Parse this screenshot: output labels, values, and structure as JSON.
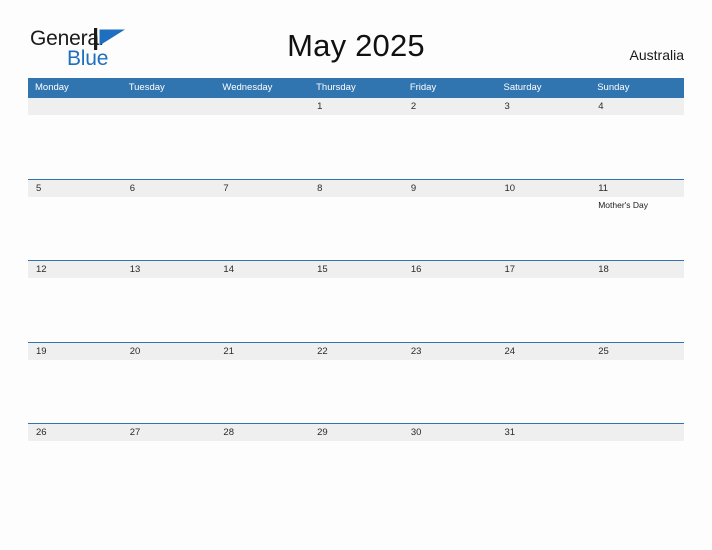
{
  "brand": {
    "name_part1": "General",
    "name_part2": "Blue",
    "flag_color": "#1f6fc0",
    "text_color": "#1a1a1a"
  },
  "header": {
    "title": "May 2025",
    "country": "Australia"
  },
  "theme": {
    "header_blue": "#3175b0",
    "date_band_gray": "#efefef",
    "page_background": "#fdfdfd",
    "accent_blue": "#1f6fc0"
  },
  "calendar": {
    "weekday_headers": [
      "Monday",
      "Tuesday",
      "Wednesday",
      "Thursday",
      "Friday",
      "Saturday",
      "Sunday"
    ],
    "weeks": [
      {
        "days": [
          {
            "num": "",
            "event": ""
          },
          {
            "num": "",
            "event": ""
          },
          {
            "num": "",
            "event": ""
          },
          {
            "num": "1",
            "event": ""
          },
          {
            "num": "2",
            "event": ""
          },
          {
            "num": "3",
            "event": ""
          },
          {
            "num": "4",
            "event": ""
          }
        ]
      },
      {
        "days": [
          {
            "num": "5",
            "event": ""
          },
          {
            "num": "6",
            "event": ""
          },
          {
            "num": "7",
            "event": ""
          },
          {
            "num": "8",
            "event": ""
          },
          {
            "num": "9",
            "event": ""
          },
          {
            "num": "10",
            "event": ""
          },
          {
            "num": "11",
            "event": "Mother's Day"
          }
        ]
      },
      {
        "days": [
          {
            "num": "12",
            "event": ""
          },
          {
            "num": "13",
            "event": ""
          },
          {
            "num": "14",
            "event": ""
          },
          {
            "num": "15",
            "event": ""
          },
          {
            "num": "16",
            "event": ""
          },
          {
            "num": "17",
            "event": ""
          },
          {
            "num": "18",
            "event": ""
          }
        ]
      },
      {
        "days": [
          {
            "num": "19",
            "event": ""
          },
          {
            "num": "20",
            "event": ""
          },
          {
            "num": "21",
            "event": ""
          },
          {
            "num": "22",
            "event": ""
          },
          {
            "num": "23",
            "event": ""
          },
          {
            "num": "24",
            "event": ""
          },
          {
            "num": "25",
            "event": ""
          }
        ]
      },
      {
        "days": [
          {
            "num": "26",
            "event": ""
          },
          {
            "num": "27",
            "event": ""
          },
          {
            "num": "28",
            "event": ""
          },
          {
            "num": "29",
            "event": ""
          },
          {
            "num": "30",
            "event": ""
          },
          {
            "num": "31",
            "event": ""
          },
          {
            "num": "",
            "event": ""
          }
        ]
      }
    ]
  }
}
